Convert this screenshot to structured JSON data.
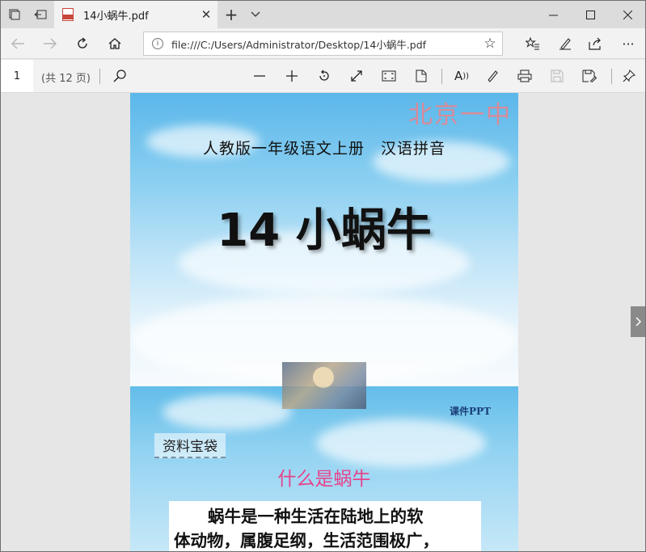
{
  "tab": {
    "title": "14小蜗牛.pdf"
  },
  "address": {
    "url": "file:///C:/Users/Administrator/Desktop/14小蜗牛.pdf"
  },
  "pdf_toolbar": {
    "page_number": "1",
    "page_count": "(共 12 页)"
  },
  "slide1": {
    "watermark": "北京一中",
    "subtitle": "人教版一年级语文上册　汉语拼音",
    "title": "14 小蜗牛"
  },
  "slide2": {
    "logo": "课件PPT",
    "section": "资料宝袋",
    "heading": "什么是蜗牛",
    "text_line1": "蜗牛是一种生活在陆地上的软",
    "text_line2": "体动物，属腹足纲，生活范围极广，"
  },
  "icons": {
    "tab_actions": "tab-actions-icon",
    "set_aside": "set-aside-tabs-icon",
    "pdf": "pdf-file-icon",
    "back": "arrow-left-icon",
    "forward": "arrow-right-icon",
    "refresh": "refresh-icon",
    "home": "home-icon",
    "favorite": "star-icon",
    "favorites_list": "favorites-list-icon",
    "pen": "pen-icon",
    "share": "share-icon",
    "more": "ellipsis-icon",
    "search": "search-icon",
    "zoom_out": "minus-icon",
    "zoom_in": "plus-icon",
    "rotate": "rotate-icon",
    "fit": "fit-page-icon",
    "fullscreen": "fullscreen-icon",
    "page_view": "page-view-icon",
    "read_aloud": "read-aloud-icon",
    "draw": "draw-icon",
    "print": "print-icon",
    "save": "save-icon",
    "save_as": "save-as-icon",
    "pin": "pin-icon",
    "next": "chevron-right-icon"
  },
  "colors": {
    "watermark": "#d98a98",
    "heading": "#e8428a",
    "pdf_red": "#c8463b"
  }
}
